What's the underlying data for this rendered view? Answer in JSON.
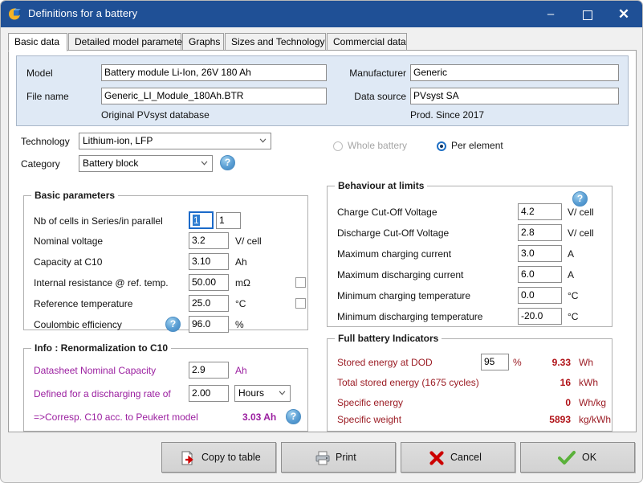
{
  "window": {
    "title": "Definitions for a battery",
    "app_icon": "pvsyst-sphere-icon",
    "minimize_label": "–",
    "maximize_label": "❑",
    "close_label": "✕",
    "accent_color": "#1f5096"
  },
  "tabs": [
    {
      "label": "Basic data",
      "active": true
    },
    {
      "label": "Detailed model parameters",
      "active": false
    },
    {
      "label": "Graphs",
      "active": false
    },
    {
      "label": "Sizes and Technology",
      "active": false
    },
    {
      "label": "Commercial data",
      "active": false
    }
  ],
  "header": {
    "model_label": "Model",
    "model_value": "Battery module Li-Ion, 26V 180 Ah",
    "file_name_label": "File name",
    "file_name_value": "Generic_LI_Module_180Ah.BTR",
    "database_note": "Original PVsyst database",
    "manufacturer_label": "Manufacturer",
    "manufacturer_value": "Generic",
    "data_source_label": "Data source",
    "data_source_value": "PVsyst SA",
    "production_note": "Prod. Since 2017",
    "panel_bg": "#dfe9f5"
  },
  "selectors": {
    "technology_label": "Technology",
    "technology_value": "Lithium-ion, LFP",
    "category_label": "Category",
    "category_value": "Battery block",
    "category_help": "help-icon"
  },
  "scope": {
    "whole_battery_label": "Whole battery",
    "whole_battery_selected": false,
    "whole_battery_disabled": true,
    "per_element_label": "Per element",
    "per_element_selected": true
  },
  "basic_parameters": {
    "title": "Basic parameters",
    "rows": [
      {
        "label": "Nb of cells in Series/in parallel",
        "value": "1",
        "value2": "1",
        "unit": "",
        "focused": true,
        "checkbox": false
      },
      {
        "label": "Nominal voltage",
        "value": "3.2",
        "unit": "V/ cell",
        "checkbox": false
      },
      {
        "label": "Capacity at C10",
        "value": "3.10",
        "unit": "Ah",
        "checkbox": false
      },
      {
        "label": "Internal resistance @ ref. temp.",
        "value": "50.00",
        "unit": "mΩ",
        "checkbox": true,
        "checked": false
      },
      {
        "label": "Reference temperature",
        "value": "25.0",
        "unit": "°C",
        "checkbox": true,
        "checked": false
      },
      {
        "label": "Coulombic efficiency",
        "value": "96.0",
        "unit": "%",
        "checkbox": false,
        "help": "help-icon"
      }
    ]
  },
  "renormalization": {
    "title": "Info : Renormalization to C10",
    "nominal_capacity_label": "Datasheet Nominal Capacity",
    "nominal_capacity_value": "2.9",
    "nominal_capacity_unit": "Ah",
    "discharge_rate_label": "Defined for a discharging rate of",
    "discharge_rate_value": "2.00",
    "discharge_rate_unit_value": "Hours",
    "result_label": "=>Corresp. C10 acc. to Peukert model",
    "result_value": "3.03 Ah",
    "result_help": "help-icon",
    "text_color": "#9b1fa0"
  },
  "behaviour_limits": {
    "title": "Behaviour at limits",
    "help": "help-icon",
    "rows": [
      {
        "label": "Charge Cut-Off Voltage",
        "value": "4.2",
        "unit": "V/ cell"
      },
      {
        "label": "Discharge Cut-Off Voltage",
        "value": "2.8",
        "unit": "V/ cell"
      },
      {
        "label": "Maximum charging current",
        "value": "3.0",
        "unit": "A"
      },
      {
        "label": "Maximum discharging current",
        "value": "6.0",
        "unit": "A"
      },
      {
        "label": "Minimum charging temperature",
        "value": "0.0",
        "unit": "°C"
      },
      {
        "label": "Minimum discharging temperature",
        "value": "-20.0",
        "unit": "°C"
      }
    ]
  },
  "full_battery_indicators": {
    "title": "Full battery Indicators",
    "dod_label": "Stored energy at DOD",
    "dod_value": "95",
    "dod_unit": "%",
    "dod_result": "9.33",
    "dod_result_unit": "Wh",
    "total_label": "Total stored energy (1675 cycles)",
    "total_value": "16",
    "total_unit": "kWh",
    "specific_energy_label": "Specific energy",
    "specific_energy_value": "0",
    "specific_energy_unit": "Wh/kg",
    "specific_weight_label": "Specific weight",
    "specific_weight_value": "5893",
    "specific_weight_unit": "kg/kWh",
    "label_color": "#9b1c24",
    "value_color": "#b01217"
  },
  "footer": {
    "copy_label": "Copy to table",
    "copy_icon": "document-arrow-icon",
    "print_label": "Print",
    "print_icon": "printer-icon",
    "cancel_label": "Cancel",
    "cancel_icon": "red-x-icon",
    "ok_label": "OK",
    "ok_icon": "green-check-icon"
  }
}
